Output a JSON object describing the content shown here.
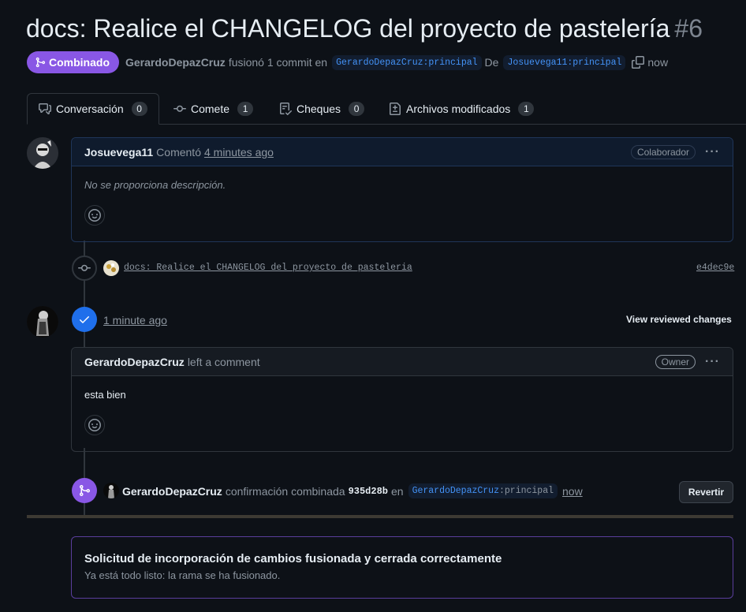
{
  "title": {
    "text": "docs: Realice el CHANGELOG del proyecto de pastelería",
    "number": "#6"
  },
  "meta": {
    "state": "Combinado",
    "user": "GerardoDepazCruz",
    "action": "fusionó 1 commit en",
    "base_branch": "GerardoDepazCruz:principal",
    "from": "De",
    "head_branch": "Josuevega11:principal",
    "time": "now"
  },
  "tabs": [
    {
      "label": "Conversación",
      "count": "0"
    },
    {
      "label": "Comete",
      "count": "1"
    },
    {
      "label": "Cheques",
      "count": "0"
    },
    {
      "label": "Archivos modificados",
      "count": "1"
    }
  ],
  "comment1": {
    "author": "Josuevega11",
    "verb": "Comentó",
    "time": "4 minutes ago",
    "role": "Colaborador",
    "body": "No se proporciona descripción."
  },
  "commit": {
    "message": "docs: Realice el CHANGELOG del proyecto de pasteleria",
    "sha": "e4dec9e"
  },
  "review": {
    "time": "1 minute ago",
    "view_changes": "View reviewed changes"
  },
  "comment2": {
    "author": "GerardoDepazCruz",
    "verb": "left a comment",
    "role": "Owner",
    "body": "esta bien"
  },
  "merge_event": {
    "user": "GerardoDepazCruz",
    "text": "confirmación combinada",
    "sha": "935d28b",
    "in": "en",
    "branch_owner": "GerardoDepazCruz",
    "branch_name": ":principal",
    "time": "now",
    "revert": "Revertir"
  },
  "merged_box": {
    "heading": "Solicitud de incorporación de cambios fusionada y cerrada correctamente",
    "sub": "Ya está todo listo: la rama se ha fusionado."
  },
  "colors": {
    "background": "#0d1117",
    "merged_purple": "#8957e5",
    "review_blue": "#1f6feb",
    "link_blue": "#4493f8"
  }
}
